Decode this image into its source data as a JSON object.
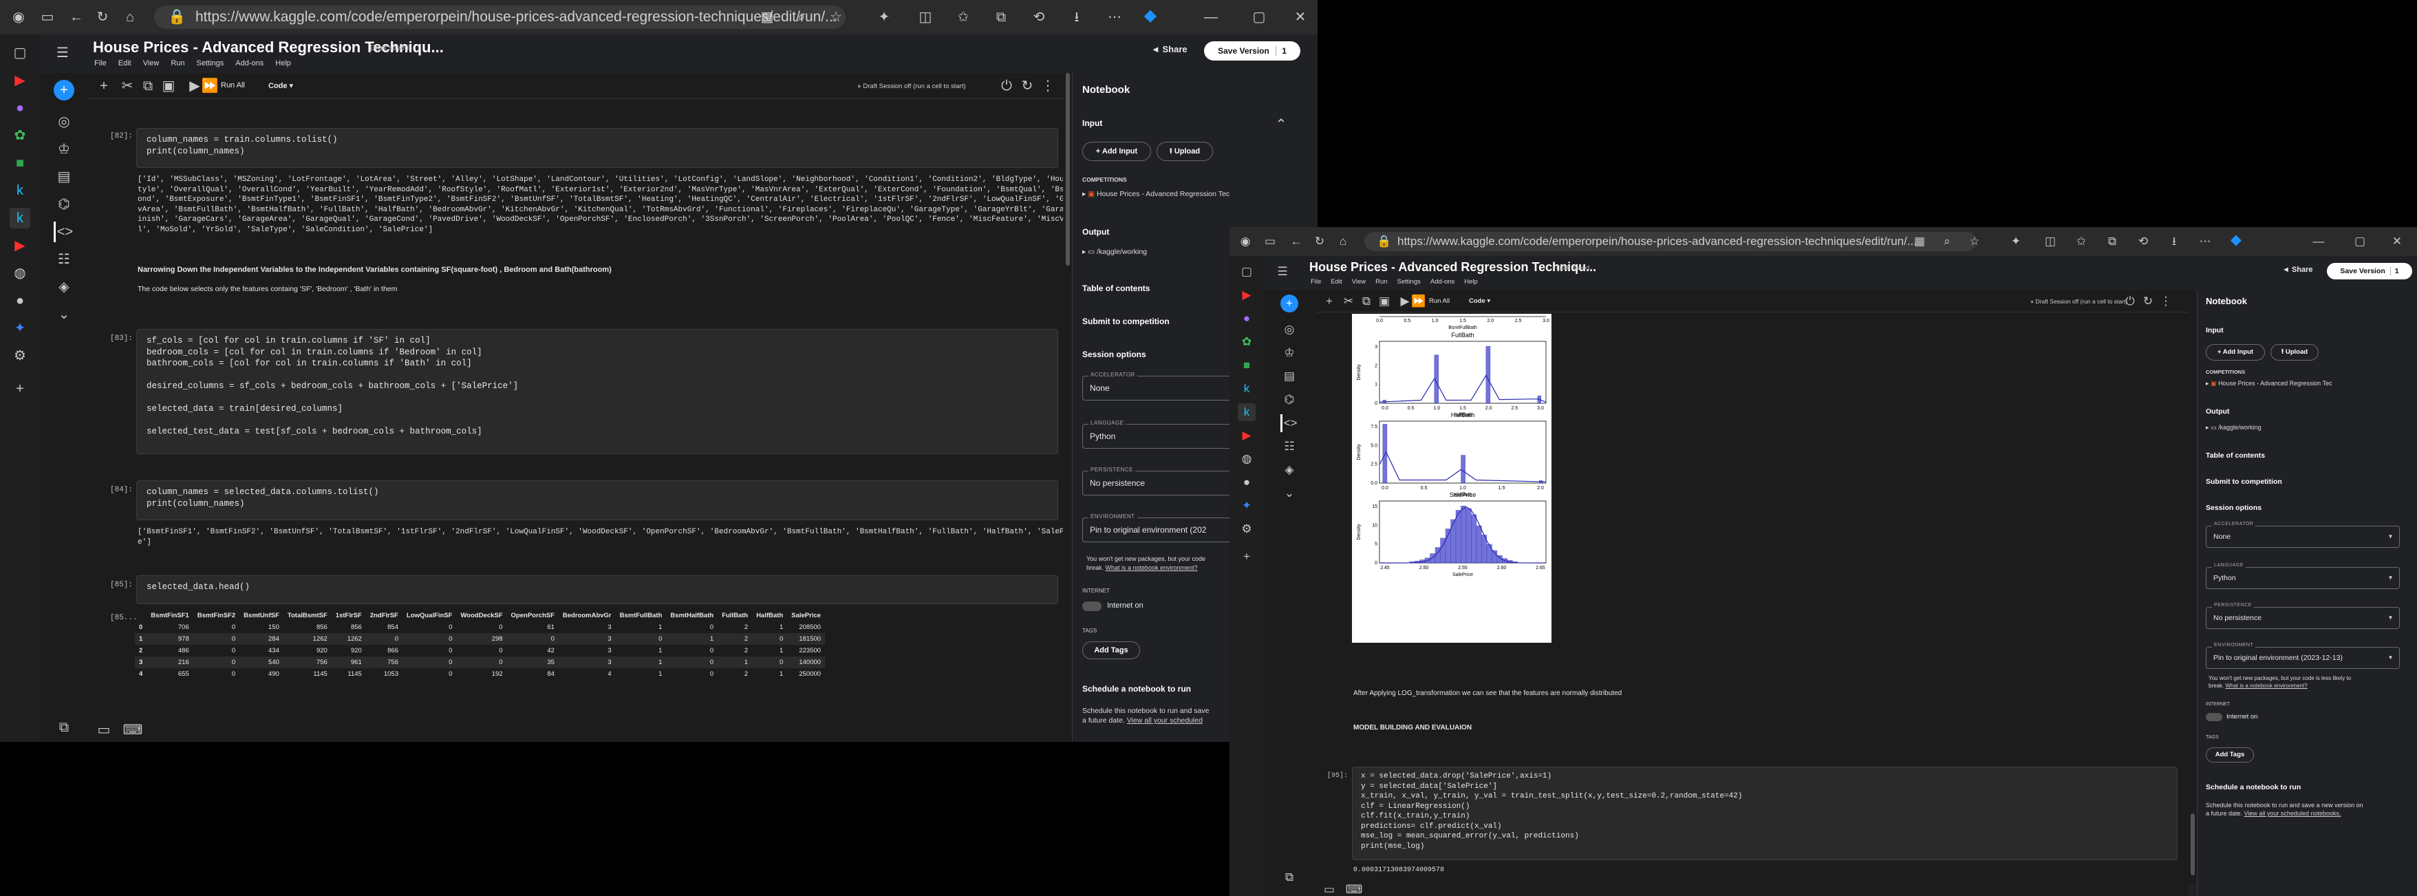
{
  "browser": {
    "url": "https://www.kaggle.com/code/emperorpein/house-prices-advanced-regression-techniques/edit/run/...",
    "url_short": "https://www.kaggle.com/code/emperorpein/house-prices-advanced-regression-techniques/edit/run/..."
  },
  "notebook": {
    "title": "House Prices - Advanced Regression Techniqu...",
    "status": "Draft saved",
    "menu": [
      "File",
      "Edit",
      "View",
      "Run",
      "Settings",
      "Add-ons",
      "Help"
    ],
    "share": "Share",
    "save_version": "Save Version",
    "save_count": "1",
    "run_all": "Run All",
    "code_dropdown": "Code",
    "session": "Draft Session off (run a cell to start)"
  },
  "left_cells": {
    "c82_label": "[82]:",
    "c82_code": "column_names = train.columns.tolist()\nprint(column_names)",
    "c82_out": "['Id', 'MSSubClass', 'MSZoning', 'LotFrontage', 'LotArea', 'Street', 'Alley', 'LotShape', 'LandContour', 'Utilities', 'LotConfig', 'LandSlope', 'Neighborhood', 'Condition1', 'Condition2', 'BldgType', 'HouseS\ntyle', 'OverallQual', 'OverallCond', 'YearBuilt', 'YearRemodAdd', 'RoofStyle', 'RoofMatl', 'Exterior1st', 'Exterior2nd', 'MasVnrType', 'MasVnrArea', 'ExterQual', 'ExterCond', 'Foundation', 'BsmtQual', 'BsmtC\nond', 'BsmtExposure', 'BsmtFinType1', 'BsmtFinSF1', 'BsmtFinType2', 'BsmtFinSF2', 'BsmtUnfSF', 'TotalBsmtSF', 'Heating', 'HeatingQC', 'CentralAir', 'Electrical', '1stFlrSF', '2ndFlrSF', 'LowQualFinSF', 'GrLi\nvArea', 'BsmtFullBath', 'BsmtHalfBath', 'FullBath', 'HalfBath', 'BedroomAbvGr', 'KitchenAbvGr', 'KitchenQual', 'TotRmsAbvGrd', 'Functional', 'Fireplaces', 'FireplaceQu', 'GarageType', 'GarageYrBlt', 'GarageF\ninish', 'GarageCars', 'GarageArea', 'GarageQual', 'GarageCond', 'PavedDrive', 'WoodDeckSF', 'OpenPorchSF', 'EnclosedPorch', '3SsnPorch', 'ScreenPorch', 'PoolArea', 'PoolQC', 'Fence', 'MiscFeature', 'MiscVa\nl', 'MoSold', 'YrSold', 'SaleType', 'SaleCondition', 'SalePrice']",
    "md_heading": "Narrowing Down the Independent Variables to the Independent Variables containing SF(square-foot) , Bedroom and Bath(bathroom)",
    "md_text": "The code below selects only the features containg 'SF', 'Bedroom' , 'Bath' in them",
    "c83_label": "[83]:",
    "c83_code": "sf_cols = [col for col in train.columns if 'SF' in col]\nbedroom_cols = [col for col in train.columns if 'Bedroom' in col]\nbathroom_cols = [col for col in train.columns if 'Bath' in col]\n\ndesired_columns = sf_cols + bedroom_cols + bathroom_cols + ['SalePrice']\n\nselected_data = train[desired_columns]\n\nselected_test_data = test[sf_cols + bedroom_cols + bathroom_cols]",
    "c84_label": "[84]:",
    "c84_code": "column_names = selected_data.columns.tolist()\nprint(column_names)",
    "c84_out": "['BsmtFinSF1', 'BsmtFinSF2', 'BsmtUnfSF', 'TotalBsmtSF', '1stFlrSF', '2ndFlrSF', 'LowQualFinSF', 'WoodDeckSF', 'OpenPorchSF', 'BedroomAbvGr', 'BsmtFullBath', 'BsmtHalfBath', 'FullBath', 'HalfBath', 'SalePric\ne']",
    "c85_label": "[85]:",
    "c85_code": "selected_data.head()",
    "c85_out_label": "[85..."
  },
  "df": {
    "columns": [
      "",
      "BsmtFinSF1",
      "BsmtFinSF2",
      "BsmtUnfSF",
      "TotalBsmtSF",
      "1stFlrSF",
      "2ndFlrSF",
      "LowQualFinSF",
      "WoodDeckSF",
      "OpenPorchSF",
      "BedroomAbvGr",
      "BsmtFullBath",
      "BsmtHalfBath",
      "FullBath",
      "HalfBath",
      "SalePrice"
    ],
    "rows": [
      [
        "0",
        "706",
        "0",
        "150",
        "856",
        "856",
        "854",
        "0",
        "0",
        "61",
        "3",
        "1",
        "0",
        "2",
        "1",
        "208500"
      ],
      [
        "1",
        "978",
        "0",
        "284",
        "1262",
        "1262",
        "0",
        "0",
        "298",
        "0",
        "3",
        "0",
        "1",
        "2",
        "0",
        "181500"
      ],
      [
        "2",
        "486",
        "0",
        "434",
        "920",
        "920",
        "866",
        "0",
        "0",
        "42",
        "3",
        "1",
        "0",
        "2",
        "1",
        "223500"
      ],
      [
        "3",
        "216",
        "0",
        "540",
        "756",
        "961",
        "756",
        "0",
        "0",
        "35",
        "3",
        "1",
        "0",
        "1",
        "0",
        "140000"
      ],
      [
        "4",
        "655",
        "0",
        "490",
        "1145",
        "1145",
        "1053",
        "0",
        "192",
        "84",
        "4",
        "1",
        "0",
        "2",
        "1",
        "250000"
      ]
    ]
  },
  "right_panel": {
    "title": "Notebook",
    "input": "Input",
    "add_input": "Add Input",
    "upload": "Upload",
    "competitions": "COMPETITIONS",
    "competition_item": "House Prices - Advanced Regression Tec",
    "output": "Output",
    "output_item": "/kaggle/working",
    "toc": "Table of contents",
    "submit": "Submit to competition",
    "session_options": "Session options",
    "accelerator_cap": "ACCELERATOR",
    "accelerator": "None",
    "language_cap": "LANGUAGE",
    "language": "Python",
    "persistence_cap": "PERSISTENCE",
    "persistence": "No persistence",
    "environment_cap": "ENVIRONMENT",
    "environment_left": "Pin to original environment (202",
    "environment_right": "Pin to original environment (2023-12-13)",
    "env_note_left": "You won't get new packages, but your code\nbreak.",
    "env_note_right": "You won't get new packages, but your code is less likely to\nbreak.",
    "env_link": "What is a notebook environment?",
    "internet_cap": "INTERNET",
    "internet": "Internet on",
    "tags_cap": "TAGS",
    "add_tags": "Add Tags",
    "schedule": "Schedule a notebook to run",
    "schedule_text_left": "Schedule this notebook to run and save\na future date.",
    "schedule_text_right": "Schedule this notebook to run and save a new version on\na future date.",
    "schedule_link_left": "View all your scheduled",
    "schedule_link_right": "View all your scheduled notebooks."
  },
  "right_cells": {
    "plot_top_xlabel": "BsmtFullBath",
    "plot_top_ticks": [
      "0.0",
      "0.5",
      "1.0",
      "1.5",
      "2.0",
      "2.5",
      "3.0"
    ],
    "plot_full_title": "FullBath",
    "plot_full_xlabel": "FullBath",
    "plot_full_ticks": [
      "0.0",
      "0.5",
      "1.0",
      "1.5",
      "2.0",
      "2.5",
      "3.0"
    ],
    "plot_full_yticks": [
      "0",
      "1",
      "2",
      "3"
    ],
    "plot_half_title": "HalfBath",
    "plot_half_xlabel": "HalfBath",
    "plot_half_ticks": [
      "0.0",
      "0.5",
      "1.0",
      "1.5",
      "2.0"
    ],
    "plot_half_yticks": [
      "0.0",
      "2.5",
      "5.0",
      "7.5"
    ],
    "plot_sale_title": "SalePrice",
    "plot_sale_xlabel": "SalePrice",
    "plot_sale_ticks": [
      "2.45",
      "2.50",
      "2.55",
      "2.60",
      "2.65"
    ],
    "plot_sale_yticks": [
      "0",
      "5",
      "10",
      "15"
    ],
    "ylabel": "Density",
    "md_log": "After Applying LOG_transformation we can see that the features are normally distributed",
    "md_model": "MODEL BUILDING AND EVALUAION",
    "c95_label": "[95]:",
    "c95_code": "x = selected_data.drop('SalePrice',axis=1)\ny = selected_data['SalePrice']\nx_train, x_val, y_train, y_val = train_test_split(x,y,test_size=0.2,random_state=42)\nclf = LinearRegression()\nclf.fit(x_train,y_train)\npredictions= clf.predict(x_val)\nmse_log = mean_squared_error(y_val, predictions)\nprint(mse_log)",
    "c95_out": "0.00031713083974009578"
  }
}
